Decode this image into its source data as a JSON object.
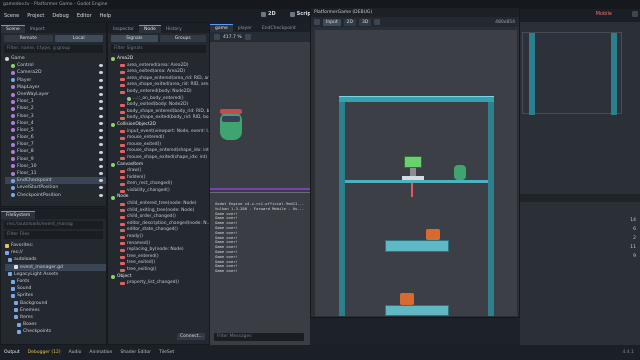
{
  "window": {
    "title": "gamedev.tv - Platformer Game - Godot Engine"
  },
  "menu": {
    "items": [
      "Scene",
      "Project",
      "Debug",
      "Editor",
      "Help"
    ],
    "workspace_2d": "2D",
    "workspace_script": "Script",
    "renderer": "Mobile"
  },
  "scene_dock": {
    "tabs": [
      "Scene",
      "Import"
    ],
    "btn_remote": "Remote",
    "btn_local": "Local",
    "filter_placeholder": "Filter: name, t:type, g:group",
    "nodes": [
      "Game",
      "Control",
      "Camera2D",
      "Player",
      "MapLayer",
      "OneWayLayer",
      "Floor_1",
      "Floor_2",
      "Floor_3",
      "Floor_4",
      "Floor_5",
      "Floor_6",
      "Floor_7",
      "Floor_8",
      "Floor_9",
      "Floor_10",
      "Floor_11",
      "EndCheckpoint",
      "LevelStartPosition",
      "CheckpointPosition"
    ],
    "selected": "EndCheckpoint"
  },
  "filesystem": {
    "title": "FileSystem",
    "path": "res://autoloads/event_manag",
    "filter_placeholder": "Filter Files",
    "items": [
      "Favorites:",
      "res://",
      "autoloads",
      "event_manager.gd",
      "LegacyLight Assets",
      "Fonts",
      "Sound",
      "Sprites",
      "Background",
      "Enemies",
      "Items",
      "Boxes",
      "Checkpoints"
    ],
    "selected": "event_manager.gd"
  },
  "inspector_dock": {
    "tabs": [
      "Inspector",
      "Node",
      "History"
    ],
    "btn_signals": "Signals",
    "btn_groups": "Groups",
    "filter_placeholder": "Filter Signals",
    "signals": [
      {
        "kind": "class",
        "text": "Area2D"
      },
      {
        "kind": "fn",
        "text": "area_entered(area: Area2D)"
      },
      {
        "kind": "fn",
        "text": "area_exited(area: Area2D)"
      },
      {
        "kind": "fn",
        "text": "area_shape_entered(area_rid: RID, ar..."
      },
      {
        "kind": "fn",
        "text": "area_shape_exited(area_rid: RID, are..."
      },
      {
        "kind": "fn",
        "text": "body_entered(body: Node2D)"
      },
      {
        "kind": "fn2",
        "text": "...::_on_body_entered()"
      },
      {
        "kind": "fn",
        "text": "body_exited(body: Node2D)"
      },
      {
        "kind": "fn",
        "text": "body_shape_entered(body_rid: RID, bo..."
      },
      {
        "kind": "fn",
        "text": "body_shape_exited(body_rid: RID, bo..."
      },
      {
        "kind": "class",
        "text": "CollisionObject2D"
      },
      {
        "kind": "fn",
        "text": "input_event(viewport: Node, event: I..."
      },
      {
        "kind": "fn",
        "text": "mouse_entered()"
      },
      {
        "kind": "fn",
        "text": "mouse_exited()"
      },
      {
        "kind": "fn",
        "text": "mouse_shape_entered(shape_idx: int)"
      },
      {
        "kind": "fn",
        "text": "mouse_shape_exited(shape_idx: int)"
      },
      {
        "kind": "class",
        "text": "CanvasItem"
      },
      {
        "kind": "fn",
        "text": "draw()"
      },
      {
        "kind": "fn",
        "text": "hidden()"
      },
      {
        "kind": "fn",
        "text": "item_rect_changed()"
      },
      {
        "kind": "fn",
        "text": "visibility_changed()"
      },
      {
        "kind": "class",
        "text": "Node"
      },
      {
        "kind": "fn",
        "text": "child_entered_tree(node: Node)"
      },
      {
        "kind": "fn",
        "text": "child_exiting_tree(node: Node)"
      },
      {
        "kind": "fn",
        "text": "child_order_changed()"
      },
      {
        "kind": "fn",
        "text": "editor_description_changed(node: N..."
      },
      {
        "kind": "fn",
        "text": "editor_state_changed()"
      },
      {
        "kind": "fn",
        "text": "ready()"
      },
      {
        "kind": "fn",
        "text": "renamed()"
      },
      {
        "kind": "fn",
        "text": "replacing_by(node: Node)"
      },
      {
        "kind": "fn",
        "text": "tree_entered()"
      },
      {
        "kind": "fn",
        "text": "tree_exited()"
      },
      {
        "kind": "fn",
        "text": "tree_exiting()"
      },
      {
        "kind": "class",
        "text": "Object"
      },
      {
        "kind": "fn",
        "text": "property_list_changed()"
      }
    ],
    "connect_btn": "Connect..."
  },
  "editor": {
    "tabs": [
      "game",
      "player",
      "EndCheckpoint"
    ],
    "zoom": "417.7 %",
    "output_filter": "Filter Messages"
  },
  "game_window": {
    "title": "PlatformerGame (DEBUG)",
    "input_label": "Input",
    "mode_2d": "2D",
    "mode_3d": "3D",
    "fps": "480x854"
  },
  "console": {
    "lines": [
      "Godot Engine v4.x.rc1.official.9ed11...",
      "Vulkan 1.3.280 - Forward Mobile - Us...",
      "Game over!",
      "Game over!",
      "Game over!",
      "Game over!",
      "Game over!",
      "Game over!",
      "Game over!",
      "Game over!",
      "Game over!",
      "Game over!",
      "Game over!",
      "Game over!",
      "Game over!"
    ]
  },
  "right_toolbar": {
    "counts": [
      "14",
      "6",
      "2",
      "11",
      "9"
    ]
  },
  "bottom": {
    "tabs": [
      "Output",
      "Debugger (12)",
      "Audio",
      "Animation",
      "Shader Editor",
      "TileSet"
    ],
    "version": "4.4.1"
  },
  "colors": {
    "accent": "#5b9cf0",
    "error": "#e06262",
    "tile": "#2c7f8c",
    "frog": "#3fa46f"
  }
}
